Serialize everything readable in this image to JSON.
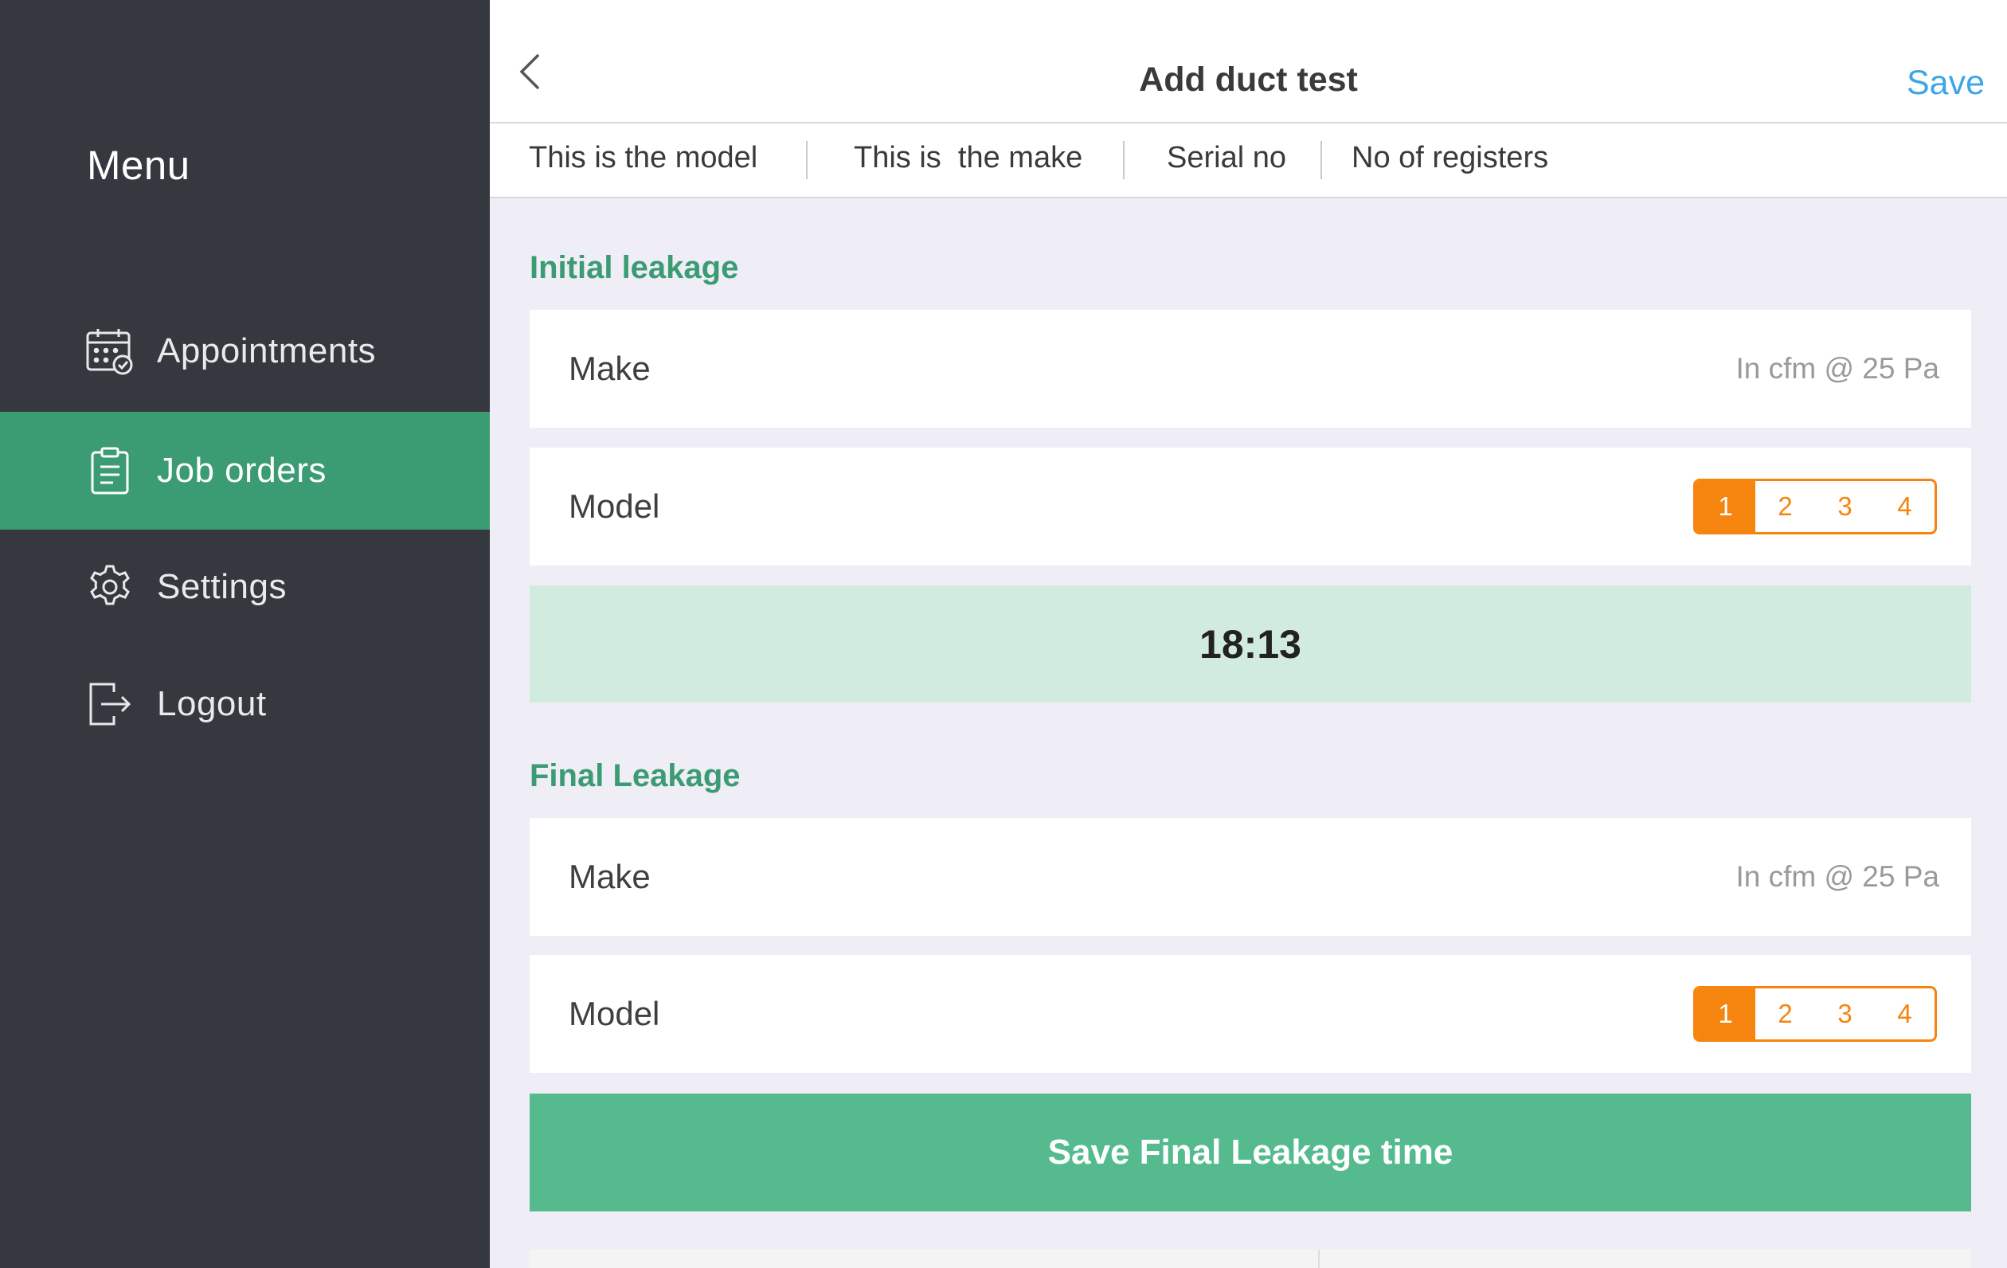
{
  "sidebar": {
    "title": "Menu",
    "items": [
      {
        "label": "Appointments",
        "icon": "calendar-check-icon"
      },
      {
        "label": "Job orders",
        "icon": "clipboard-icon",
        "active": true
      },
      {
        "label": "Settings",
        "icon": "gear-icon"
      },
      {
        "label": "Logout",
        "icon": "logout-icon"
      }
    ]
  },
  "header": {
    "title": "Add duct test",
    "save_label": "Save"
  },
  "info": {
    "model": "This is the model",
    "make": "This is  the make",
    "serial": "Serial no",
    "registers": "No of registers"
  },
  "initial": {
    "title": "Initial leakage",
    "make_label": "Make",
    "make_hint": "In cfm @ 25 Pa",
    "model_label": "Model",
    "options": [
      "1",
      "2",
      "3",
      "4"
    ],
    "selected": "1",
    "timer": "18:13"
  },
  "final": {
    "title": "Final Leakage",
    "make_label": "Make",
    "make_hint": "In cfm @ 25 Pa",
    "model_label": "Model",
    "options": [
      "1",
      "2",
      "3",
      "4"
    ],
    "selected": "1",
    "save_button": "Save Final Leakage time"
  },
  "colors": {
    "sidebar_bg": "#35393f",
    "active_green": "#3b9b73",
    "accent_orange": "#f5850e",
    "link_blue": "#3da5e8",
    "button_green": "#55bb8f",
    "timer_bg": "#d2ebdf"
  }
}
